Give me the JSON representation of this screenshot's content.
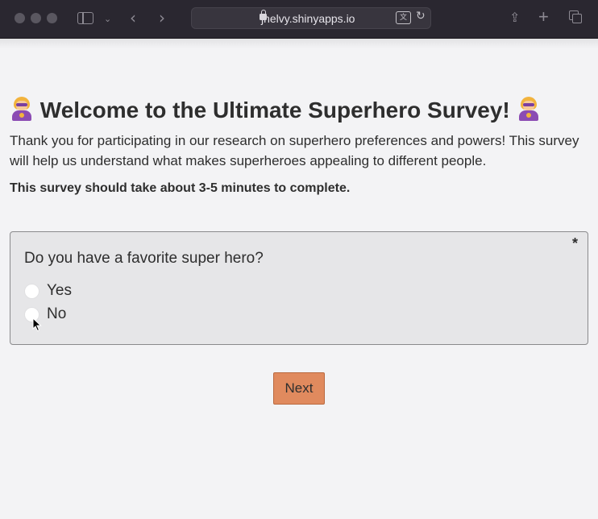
{
  "browser": {
    "url": "jhelvy.shinyapps.io",
    "icons": [
      "sidebar-icon",
      "chevron-down-icon",
      "back-icon",
      "forward-icon",
      "lock-icon",
      "translate-icon",
      "reload-icon",
      "share-icon",
      "new-tab-icon",
      "tabs-icon"
    ]
  },
  "survey": {
    "title": "Welcome to the Ultimate Superhero Survey!",
    "intro": "Thank you for participating in our research on superhero preferences and powers! This survey will help us understand what makes superheroes appealing to different people.",
    "duration_note": "This survey should take about 3-5 minutes to complete.",
    "question": {
      "text": "Do you have a favorite super hero?",
      "required_mark": "*",
      "options": [
        {
          "label": "Yes"
        },
        {
          "label": "No"
        }
      ]
    },
    "next_label": "Next"
  },
  "colors": {
    "chrome": "#2a2730",
    "page_bg": "#f3f3f5",
    "card_bg": "#e6e6e8",
    "next_button": "#e08a5e",
    "text": "#2e2e2e"
  }
}
